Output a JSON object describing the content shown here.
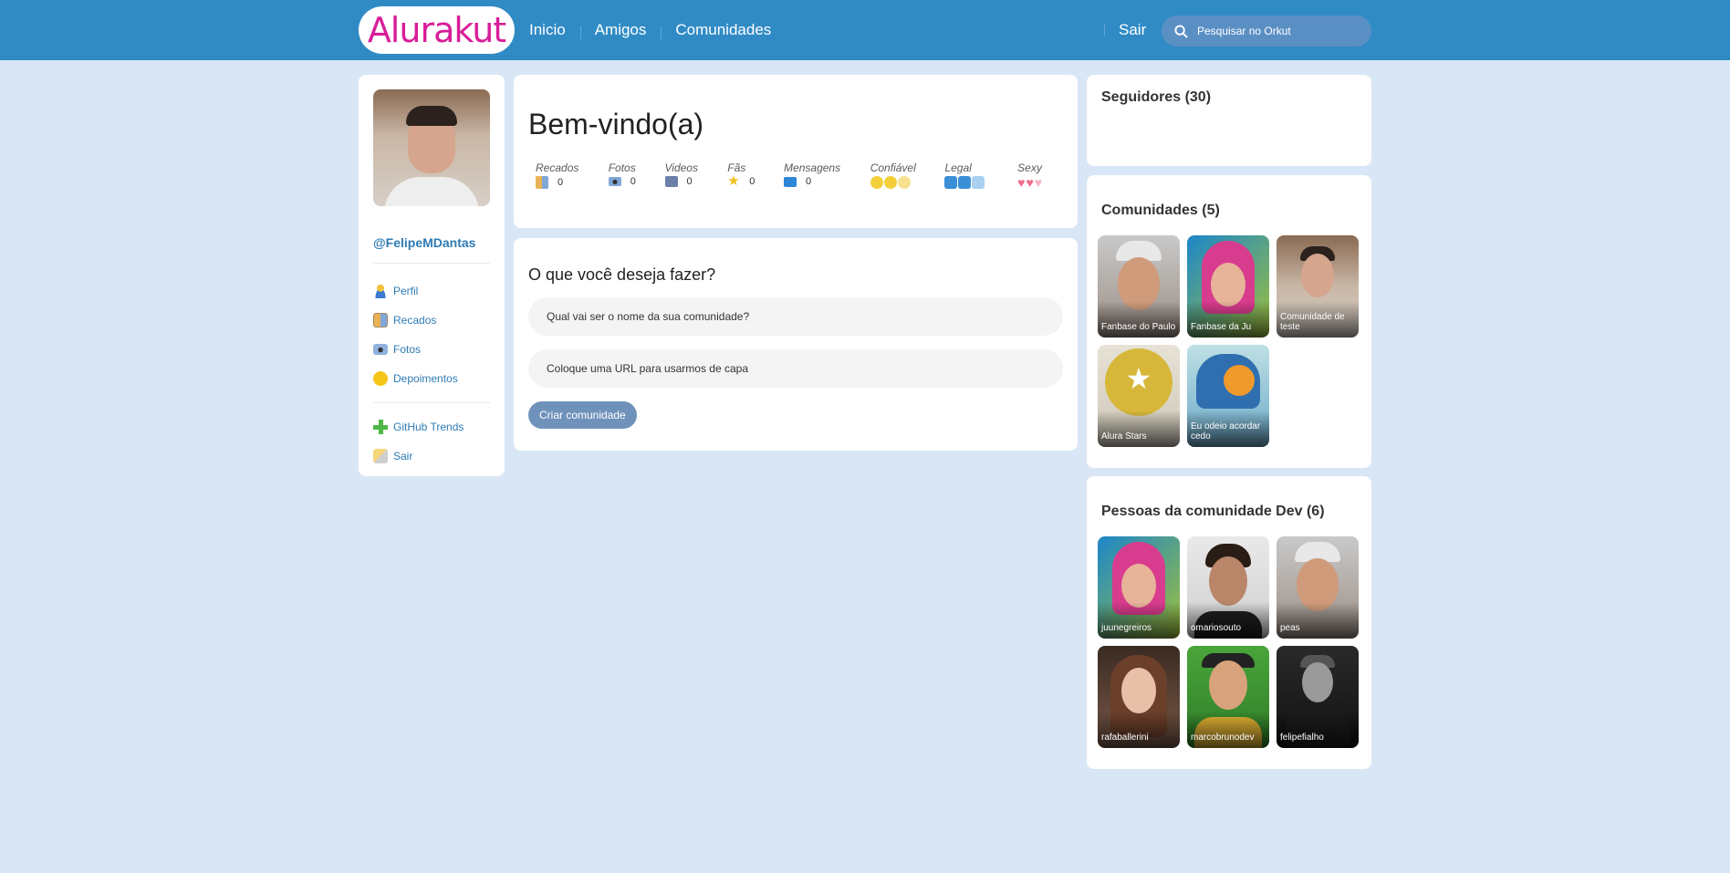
{
  "header": {
    "logo": "Alurakut",
    "nav": [
      "Inicio",
      "Amigos",
      "Comunidades"
    ],
    "logout": "Sair",
    "search_placeholder": "Pesquisar no Orkut"
  },
  "sidebar": {
    "username": "@FelipeMDantas",
    "items": [
      {
        "label": "Perfil",
        "icon": "user-icon"
      },
      {
        "label": "Recados",
        "icon": "book-icon"
      },
      {
        "label": "Fotos",
        "icon": "camera-icon"
      },
      {
        "label": "Depoimentos",
        "icon": "sun-icon"
      }
    ],
    "items2": [
      {
        "label": "GitHub Trends",
        "icon": "plus-icon"
      },
      {
        "label": "Sair",
        "icon": "logout-icon"
      }
    ]
  },
  "welcome": {
    "title": "Bem-vindo(a)",
    "stats": [
      {
        "label": "Recados",
        "value": "0"
      },
      {
        "label": "Fotos",
        "value": "0"
      },
      {
        "label": "Videos",
        "value": "0"
      },
      {
        "label": "Fãs",
        "value": "0"
      },
      {
        "label": "Mensagens",
        "value": "0"
      },
      {
        "label": "Confiável"
      },
      {
        "label": "Legal"
      },
      {
        "label": "Sexy"
      }
    ]
  },
  "form": {
    "heading": "O que você deseja fazer?",
    "name_placeholder": "Qual vai ser o nome da sua comunidade?",
    "url_placeholder": "Coloque uma URL para usarmos de capa",
    "submit": "Criar comunidade"
  },
  "followers": {
    "title": "Seguidores (30)"
  },
  "communities": {
    "title": "Comunidades (5)",
    "items": [
      "Fanbase do Paulo",
      "Fanbase da Ju",
      "Comunidade de teste",
      "Alura Stars",
      "Eu odeio acordar cedo"
    ]
  },
  "people": {
    "title": "Pessoas da comunidade Dev (6)",
    "items": [
      "juunegreiros",
      "omariosouto",
      "peas",
      "rafaballerini",
      "marcobrunodev",
      "felipefialho"
    ]
  },
  "colors": {
    "header": "#308bc5",
    "background": "#d9e6f6",
    "logo": "#d81d99",
    "link": "#2e7bb4",
    "button": "#6f92bb"
  }
}
